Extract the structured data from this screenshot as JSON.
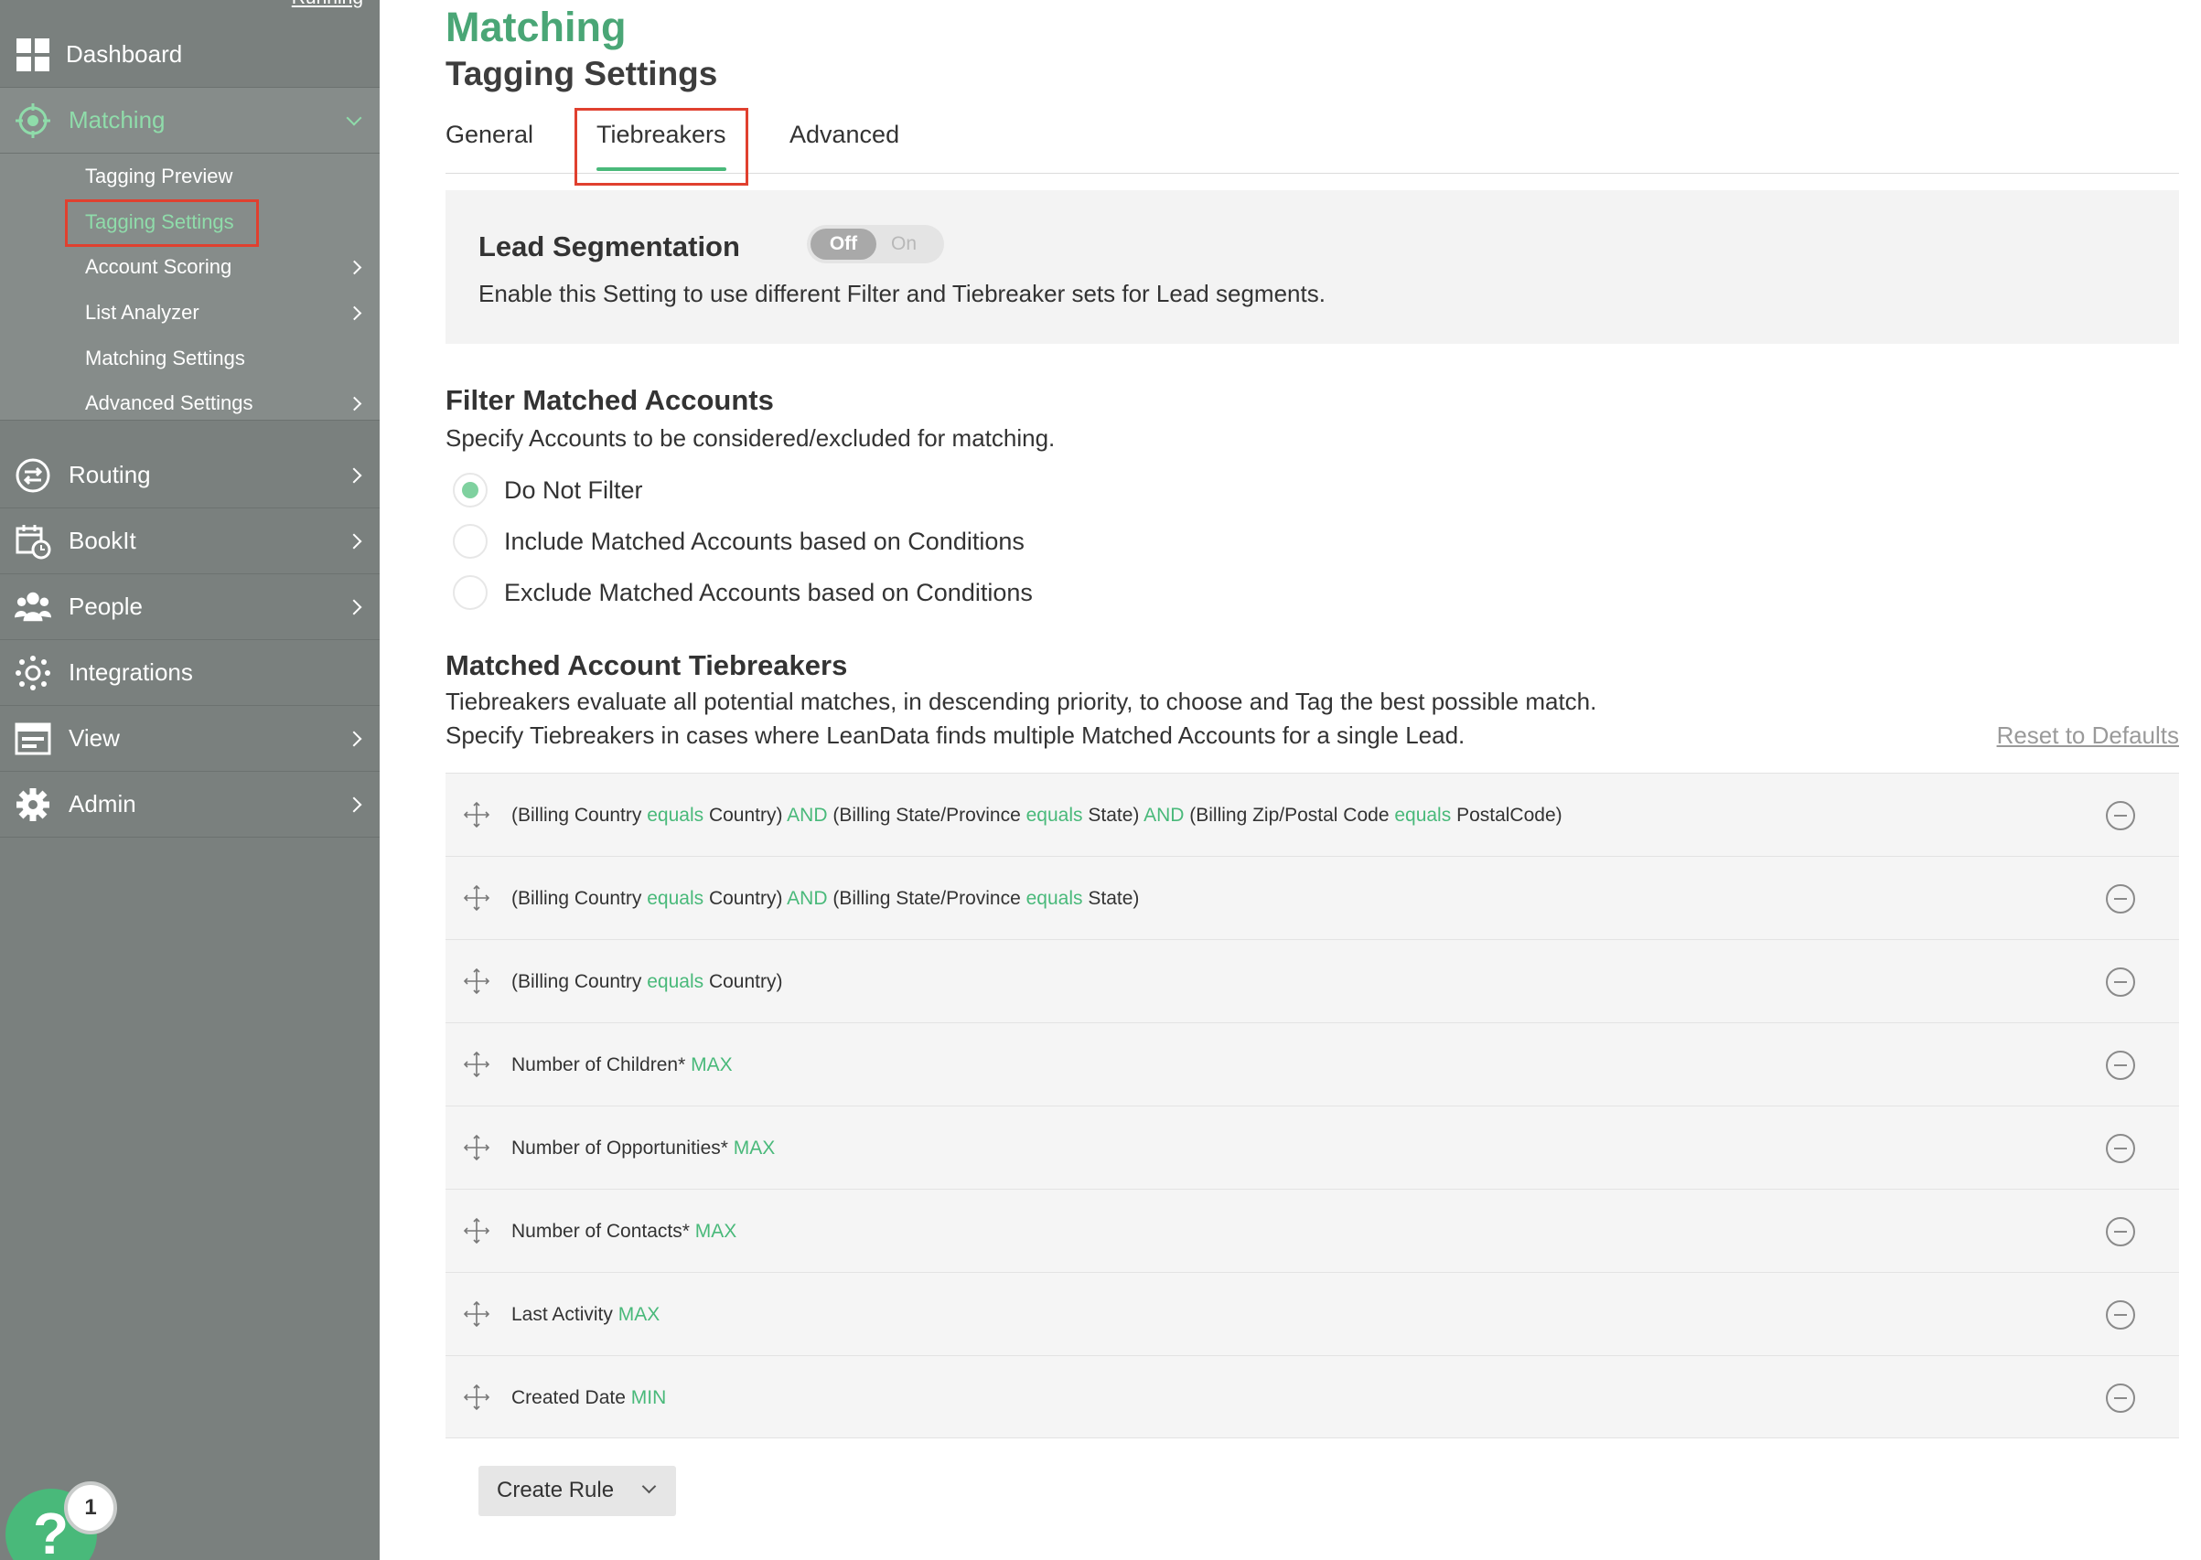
{
  "sidebar": {
    "top_link": "Running",
    "nav": {
      "dashboard": {
        "label": "Dashboard",
        "icon": "dashboard-grid-icon"
      },
      "matching": {
        "label": "Matching",
        "icon": "target-icon"
      },
      "routing": {
        "label": "Routing",
        "icon": "routing-arrows-icon"
      },
      "bookit": {
        "label": "BookIt",
        "icon": "calendar-clock-icon"
      },
      "people": {
        "label": "People",
        "icon": "people-icon"
      },
      "integrations": {
        "label": "Integrations",
        "icon": "integrations-hub-icon"
      },
      "view": {
        "label": "View",
        "icon": "window-view-icon"
      },
      "admin": {
        "label": "Admin",
        "icon": "gear-icon"
      }
    },
    "matching_sub": {
      "tagging_preview": "Tagging Preview",
      "tagging_settings": "Tagging Settings",
      "account_scoring": "Account Scoring",
      "list_analyzer": "List Analyzer",
      "matching_settings": "Matching Settings",
      "advanced_settings": "Advanced Settings"
    },
    "help": {
      "label": "?",
      "badge_count": "1"
    }
  },
  "header": {
    "title": "Matching",
    "subtitle": "Tagging Settings"
  },
  "tabs": {
    "general": "General",
    "tiebreakers": "Tiebreakers",
    "advanced": "Advanced",
    "active": "Tiebreakers"
  },
  "lead_segmentation": {
    "title": "Lead Segmentation",
    "toggle_off": "Off",
    "toggle_on": "On",
    "state": "Off",
    "description": "Enable this Setting to use different Filter and Tiebreaker sets for Lead segments."
  },
  "filter": {
    "title": "Filter Matched Accounts",
    "description": "Specify Accounts to be considered/excluded for matching.",
    "options": {
      "do_not_filter": "Do Not Filter",
      "include": "Include Matched Accounts based on Conditions",
      "exclude": "Exclude Matched Accounts based on Conditions"
    },
    "selected": "Do Not Filter"
  },
  "tiebreakers": {
    "title": "Matched Account Tiebreakers",
    "description_1": "Tiebreakers evaluate all potential matches, in descending priority, to choose and Tag the best possible match.",
    "description_2": "Specify Tiebreakers in cases where LeanData finds multiple Matched Accounts for a single Lead.",
    "reset_label": "Reset to Defaults",
    "rules": {
      "r1": {
        "a": "(Billing Country ",
        "b": "equals",
        "c": " Country) ",
        "d": "AND",
        "e": " (Billing State/Province ",
        "f": "equals",
        "g": " State) ",
        "h": "AND",
        "i": " (Billing Zip/Postal Code ",
        "j": "equals",
        "k": " PostalCode)"
      },
      "r2": {
        "a": "(Billing Country ",
        "b": "equals",
        "c": " Country) ",
        "d": "AND",
        "e": " (Billing State/Province ",
        "f": "equals",
        "g": " State)"
      },
      "r3": {
        "a": "(Billing Country ",
        "b": "equals",
        "c": " Country)"
      },
      "r4": {
        "a": "Number of Children* ",
        "b": "MAX"
      },
      "r5": {
        "a": "Number of Opportunities* ",
        "b": "MAX"
      },
      "r6": {
        "a": "Number of Contacts* ",
        "b": "MAX"
      },
      "r7": {
        "a": "Last Activity ",
        "b": "MAX"
      },
      "r8": {
        "a": "Created Date ",
        "b": "MIN"
      }
    },
    "create_rule_label": "Create Rule"
  },
  "colors": {
    "accent_green": "#49b97a",
    "title_green": "#4aa676",
    "sidebar_bg": "#7a807e",
    "highlight_red": "#e0402f"
  }
}
